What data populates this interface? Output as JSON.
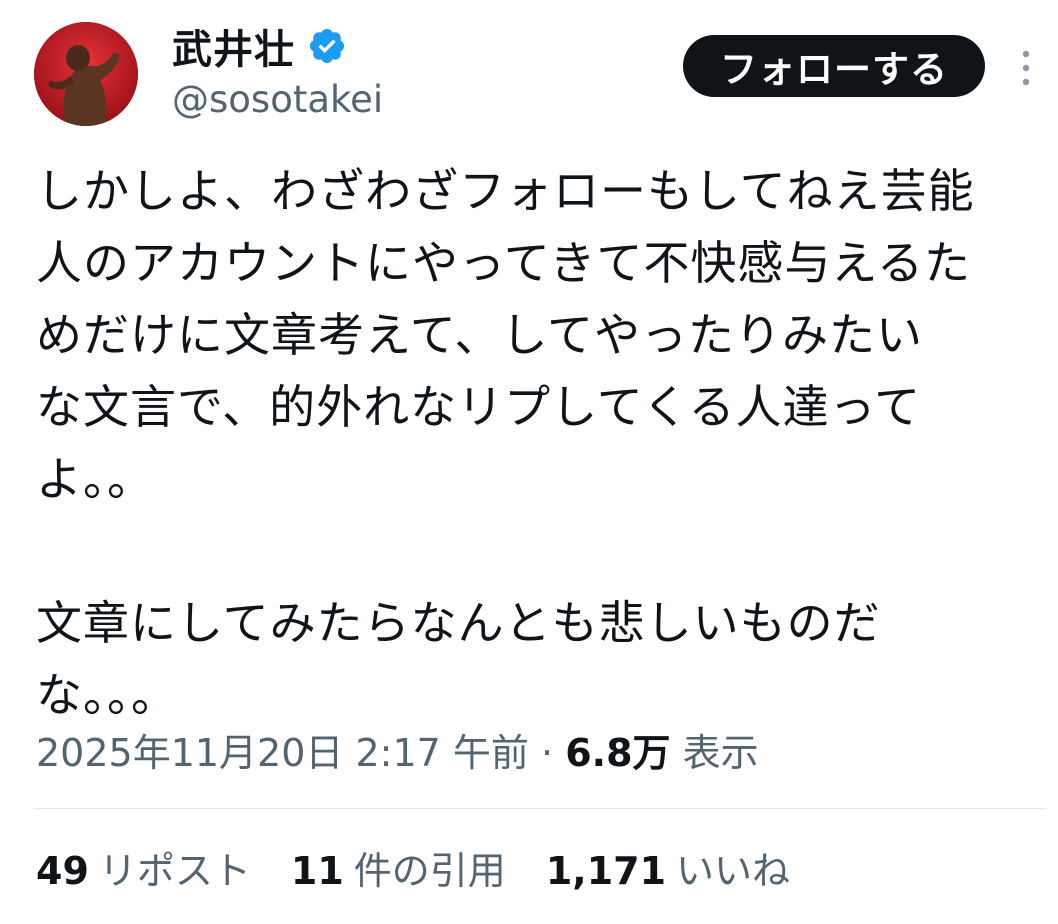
{
  "tweet": {
    "author": {
      "display_name": "武井壮",
      "handle": "@sosotakei",
      "verified": true
    },
    "follow_button_label": "フォローする",
    "text": "しかしよ、わざわざフォローもしてねえ芸能\n人のアカウントにやってきて不快感与えるた\nめだけに文章考えて、してやったりみたい\nな文言で、的外れなリプしてくる人達って\nよ。。\n\n文章にしてみたらなんとも悲しいものだ\nな。。。",
    "timestamp": "2025年11月20日 2:17 午前",
    "separator": "·",
    "views_count": "6.8万",
    "views_label": "表示",
    "stats": {
      "reposts": {
        "count": "49",
        "label": "リポスト"
      },
      "quotes": {
        "count": "11",
        "label": "件の引用"
      },
      "likes": {
        "count": "1,171",
        "label": "いいね"
      }
    }
  },
  "colors": {
    "text_primary": "#0f1419",
    "text_secondary": "#536471",
    "verified_blue": "#1d9bf0",
    "button_bg": "#0f1419",
    "divider": "#e1e6ea"
  },
  "icons": {
    "avatar": "avatar-photo",
    "verified": "verified-badge-icon",
    "more": "more-options-icon"
  }
}
